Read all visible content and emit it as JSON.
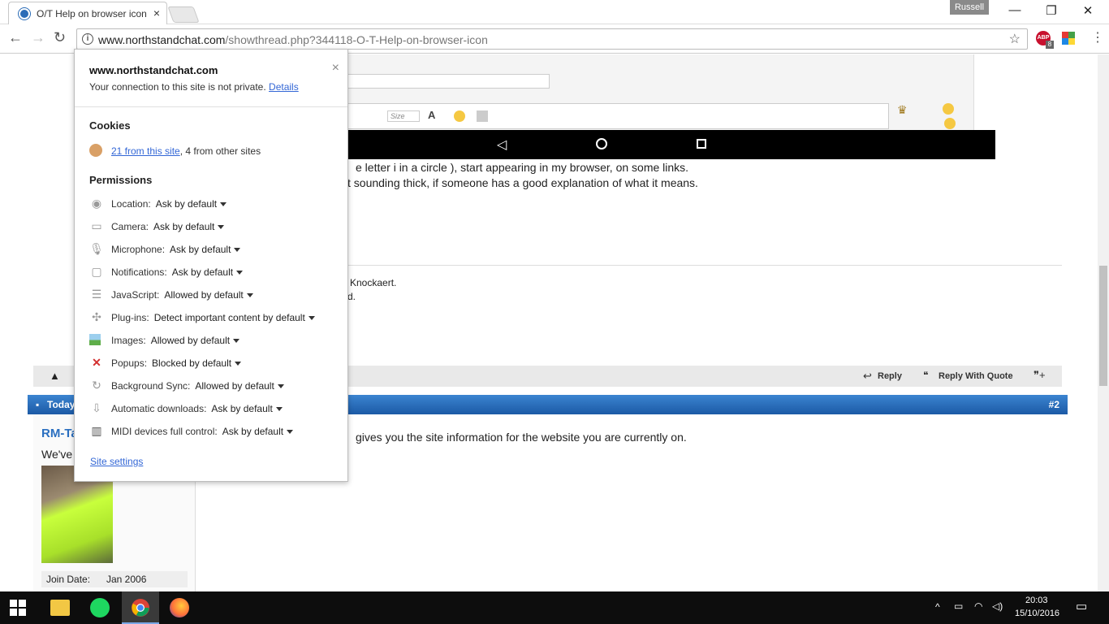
{
  "browser": {
    "tab_title": "O/T Help on browser icon",
    "tab_close": "×",
    "profile_name": "Russell",
    "window_controls": [
      "—",
      "❐",
      "✕"
    ],
    "url_host": "www.northstandchat.com",
    "url_path": "/showthread.php?344118-O-T-Help-on-browser-icon",
    "extensions": {
      "abp_badge": "8",
      "abp_label": "ABP"
    }
  },
  "page": {
    "editor_size_label": "Size",
    "post_line1": "e letter i in a circle ), start appearing in my browser, on some links.",
    "post_line2": "t sounding thick, if someone has a good explanation of what it means.",
    "sig_line1": "Knockaert.",
    "sig_line2": "d.",
    "reply_label": "Reply",
    "reply_quote_label": "Reply With Quote",
    "post_header_left": "Today",
    "post_number": "#2",
    "username_partial": "RM-Ta",
    "user_title_partial": "We've",
    "reply_text": "gives you the site information for the website you are currently on.",
    "join_date_label": "Join Date:",
    "join_date_value": "Jan 2006"
  },
  "popup": {
    "host": "www.northstandchat.com",
    "close": "×",
    "connection_text": "Your connection to this site is not private.",
    "details_link": "Details",
    "cookies_heading": "Cookies",
    "cookies_link": "21 from this site",
    "cookies_rest": ", 4 from other sites",
    "permissions_heading": "Permissions",
    "permissions": [
      {
        "label": "Location:",
        "value": "Ask by default",
        "icon": "location-icon"
      },
      {
        "label": "Camera:",
        "value": "Ask by default",
        "icon": "camera-icon"
      },
      {
        "label": "Microphone:",
        "value": "Ask by default",
        "icon": "microphone-icon"
      },
      {
        "label": "Notifications:",
        "value": "Ask by default",
        "icon": "notifications-icon"
      },
      {
        "label": "JavaScript:",
        "value": "Allowed by default",
        "icon": "javascript-icon"
      },
      {
        "label": "Plug-ins:",
        "value": "Detect important content by default",
        "icon": "plugin-icon"
      },
      {
        "label": "Images:",
        "value": "Allowed by default",
        "icon": "image-icon"
      },
      {
        "label": "Popups:",
        "value": "Blocked by default",
        "icon": "popup-blocked-icon"
      },
      {
        "label": "Background Sync:",
        "value": "Allowed by default",
        "icon": "sync-icon"
      },
      {
        "label": "Automatic downloads:",
        "value": "Ask by default",
        "icon": "download-icon"
      },
      {
        "label": "MIDI devices full control:",
        "value": "Ask by default",
        "icon": "midi-icon"
      }
    ],
    "site_settings_link": "Site settings"
  },
  "taskbar": {
    "time": "20:03",
    "date": "15/10/2016"
  },
  "colors": {
    "link": "#3367d6",
    "forum_blue": "#2a6fc0",
    "taskbar": "#0d0d0d"
  }
}
